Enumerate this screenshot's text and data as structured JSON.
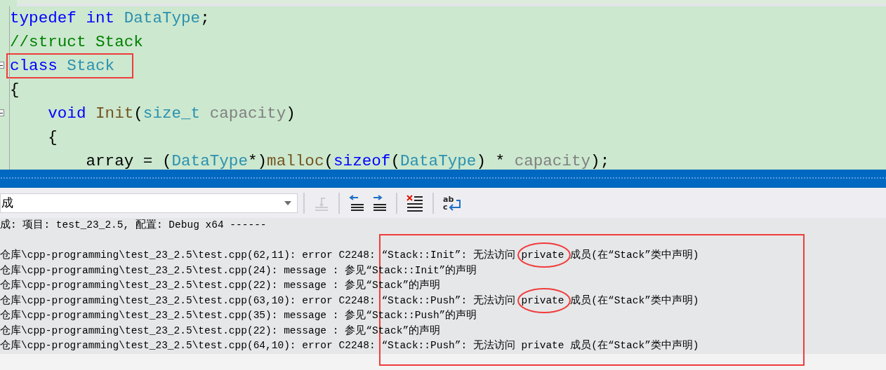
{
  "editor": {
    "lines": [
      {
        "tokens": [
          {
            "text": "typedef ",
            "kind": "keyword"
          },
          {
            "text": "int ",
            "kind": "keyword"
          },
          {
            "text": "DataType",
            "kind": "type"
          },
          {
            "text": ";",
            "kind": "plain"
          }
        ]
      },
      {
        "tokens": [
          {
            "text": "//struct Stack",
            "kind": "comment"
          }
        ]
      },
      {
        "boxed": true,
        "foldable": true,
        "tokens": [
          {
            "text": "class ",
            "kind": "keyword"
          },
          {
            "text": "Stack",
            "kind": "type"
          }
        ]
      },
      {
        "tokens": [
          {
            "text": "{",
            "kind": "plain"
          }
        ]
      },
      {
        "foldable": true,
        "tokens": [
          {
            "text": "    void ",
            "kind": "keyword"
          },
          {
            "text": "Init",
            "kind": "func"
          },
          {
            "text": "(",
            "kind": "plain"
          },
          {
            "text": "size_t ",
            "kind": "type"
          },
          {
            "text": "capacity",
            "kind": "param"
          },
          {
            "text": ")",
            "kind": "plain"
          }
        ]
      },
      {
        "tokens": [
          {
            "text": "    {",
            "kind": "plain"
          }
        ]
      },
      {
        "tokens": [
          {
            "text": "        array = (",
            "kind": "plain"
          },
          {
            "text": "DataType",
            "kind": "type"
          },
          {
            "text": "*)",
            "kind": "plain"
          },
          {
            "text": "malloc",
            "kind": "func"
          },
          {
            "text": "(",
            "kind": "plain"
          },
          {
            "text": "sizeof",
            "kind": "keyword"
          },
          {
            "text": "(",
            "kind": "plain"
          },
          {
            "text": "DataType",
            "kind": "type"
          },
          {
            "text": ") * ",
            "kind": "plain"
          },
          {
            "text": "capacity",
            "kind": "param"
          },
          {
            "text": ");",
            "kind": "plain"
          }
        ]
      }
    ]
  },
  "output": {
    "source_dropdown": {
      "value": "成"
    },
    "toolbar": [
      {
        "kind": "goto",
        "disabled": true
      },
      {
        "kind": "prev",
        "disabled": false
      },
      {
        "kind": "next",
        "disabled": false
      },
      {
        "kind": "clear",
        "disabled": false
      },
      {
        "kind": "wrap",
        "disabled": false,
        "glyphs": [
          "ab",
          "c"
        ]
      }
    ],
    "annotated": true,
    "header": "成: 项目: test_23_2.5, 配置: Debug x64 ------",
    "lines": [
      {
        "segments": [
          {
            "text": "仓库\\cpp-programming\\test_23_2.5\\test.cpp(62,11): error C2248: “Stack::Init”: 无法访问 "
          },
          {
            "text": "private",
            "circled": true
          },
          {
            "text": " 成员(在“Stack”类中声明)"
          }
        ]
      },
      {
        "segments": [
          {
            "text": "仓库\\cpp-programming\\test_23_2.5\\test.cpp(24): message : 参见“Stack::Init”的声明",
            "circled": false
          }
        ]
      },
      {
        "segments": [
          {
            "text": "仓库\\cpp-programming\\test_23_2.5\\test.cpp(22): message : 参见“Stack”的声明",
            "circled": false
          }
        ]
      },
      {
        "segments": [
          {
            "text": "仓库\\cpp-programming\\test_23_2.5\\test.cpp(63,10): error C2248: “Stack::Push”: 无法访问 "
          },
          {
            "text": "private",
            "circled": true
          },
          {
            "text": " 成员(在“Stack”类中声明)"
          }
        ]
      },
      {
        "segments": [
          {
            "text": "仓库\\cpp-programming\\test_23_2.5\\test.cpp(35): message : 参见“Stack::Push”的声明",
            "circled": false
          }
        ]
      },
      {
        "segments": [
          {
            "text": "仓库\\cpp-programming\\test_23_2.5\\test.cpp(22): message : 参见“Stack”的声明",
            "circled": false
          }
        ]
      },
      {
        "segments": [
          {
            "text": "仓库\\cpp-programming\\test_23_2.5\\test.cpp(64,10): error C2248: “Stack::Push”: 无法访问 private 成员(在“Stack”类中声明)",
            "circled": false
          }
        ]
      }
    ]
  }
}
